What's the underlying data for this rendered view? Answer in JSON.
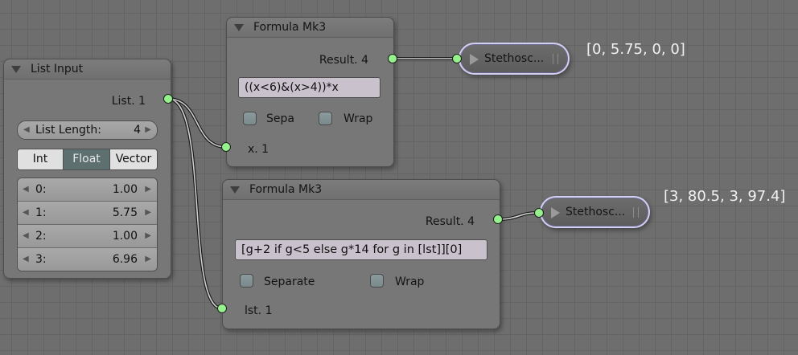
{
  "list_input": {
    "title": "List Input",
    "output_label": "List. 1",
    "length_label": "List Length:",
    "length_value": "4",
    "type_options": [
      "Int",
      "Float",
      "Vector"
    ],
    "selected_type": "Float",
    "items": [
      {
        "key": "0:",
        "value": "1.00"
      },
      {
        "key": "1:",
        "value": "5.75"
      },
      {
        "key": "2:",
        "value": "1.00"
      },
      {
        "key": "3:",
        "value": "6.96"
      }
    ]
  },
  "formula1": {
    "title": "Formula Mk3",
    "result_label": "Result. 4",
    "expression": "((x<6)&(x>4))*x",
    "checkbox_separate": "Sepa",
    "checkbox_wrap": "Wrap",
    "input_label": "x. 1"
  },
  "formula2": {
    "title": "Formula Mk3",
    "result_label": "Result. 4",
    "expression": "[g+2 if g<5 else g*14 for g in [lst]][0]",
    "checkbox_separate": "Separate",
    "checkbox_wrap": "Wrap",
    "input_label": "lst. 1"
  },
  "stethoscope1": {
    "title": "Stethosc...",
    "output": "[0, 5.75, 0, 0]"
  },
  "stethoscope2": {
    "title": "Stethosc...",
    "output": "[3, 80.5, 3, 97.4]"
  },
  "colors": {
    "socket": "#96f28c",
    "selected_toggle": "#5e6f70",
    "text_field": "#c9c1cc",
    "stethoscope_border": "#d3cff2"
  }
}
